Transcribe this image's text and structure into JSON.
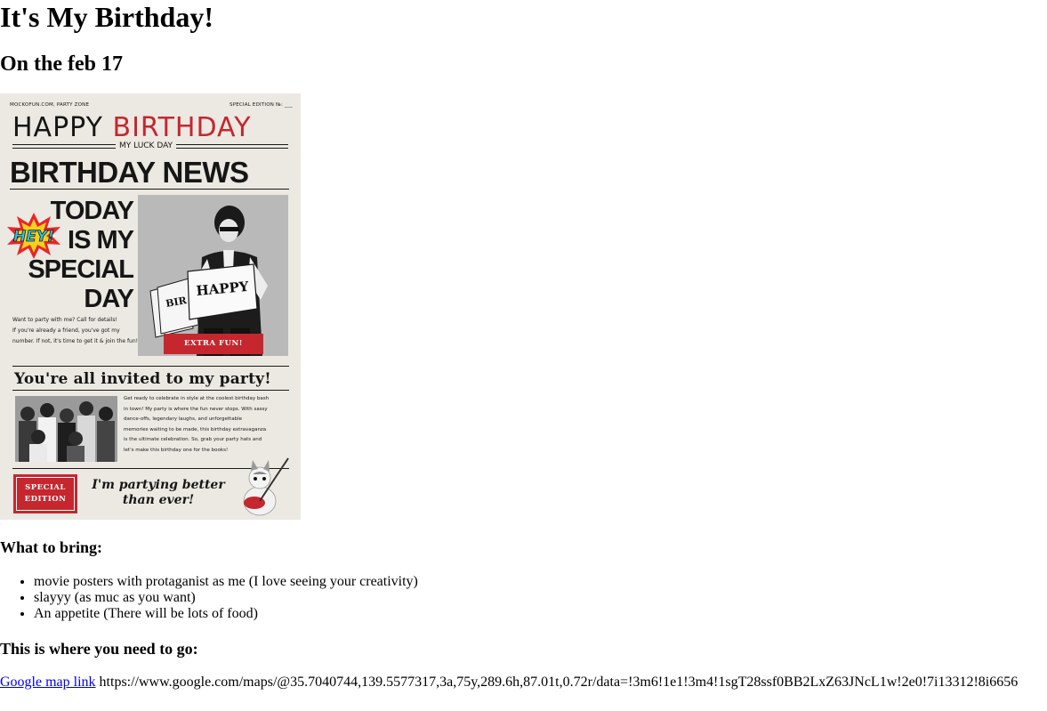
{
  "page": {
    "title": "It's My Birthday!",
    "subtitle": "On the feb 17"
  },
  "poster": {
    "masthead_left": "MOCKOFUN.COM, PARTY ZONE",
    "masthead_right": "SPECIAL EDITION №: ___",
    "happy_word": "HAPPY",
    "birthday_word": "BIRTHDAY",
    "tagline": "MY LUCK DAY",
    "headline": "BIRTHDAY NEWS",
    "hey_text": "HEY!",
    "big_lines": [
      "TODAY",
      "IS MY",
      "SPECIAL",
      "DAY"
    ],
    "blurb_lines": [
      "Want to party with me? Call for details!",
      "If you're already a friend, you've got my",
      "number. If not, it's time to get it & join the fun!"
    ],
    "sign_left": "BIR",
    "sign_text": "HAPPY",
    "extra_label": "EXTRA FUN!",
    "invited_heading": "You're all invited to my party!",
    "paragraph_lines": [
      "Get ready to celebrate in style at the coolest birthday bash",
      "in town! My party is where the fun never stops. With sassy",
      "dance-offs, legendary laughs, and unforgettable",
      "memories waiting to be made, this birthday extravaganza",
      "is the ultimate celebration. So, grab your party hats and",
      "let's make this birthday one for the books!"
    ],
    "special_line1": "SPECIAL",
    "special_line2": "EDITION",
    "partying_line1": "I'm partying better",
    "partying_line2": "than ever!",
    "colors": {
      "accent_red": "#c6262e",
      "paper": "#ece9e2",
      "ink": "#161616"
    }
  },
  "bring": {
    "heading": "What to bring:",
    "items": [
      "movie posters with protaganist as me (I love seeing your creativity)",
      "slayyy (as muc as you want)",
      "An appetite (There will be lots of food)"
    ]
  },
  "location": {
    "heading": "This is where you need to go:",
    "link_text": "Google map link",
    "url_text": "https://www.google.com/maps/@35.7040744,139.5577317,3a,75y,289.6h,87.01t,0.72r/data=!3m6!1e1!3m4!1sgT28ssf0BB2LxZ63JNcL1w!2e0!7i13312!8i6656"
  }
}
